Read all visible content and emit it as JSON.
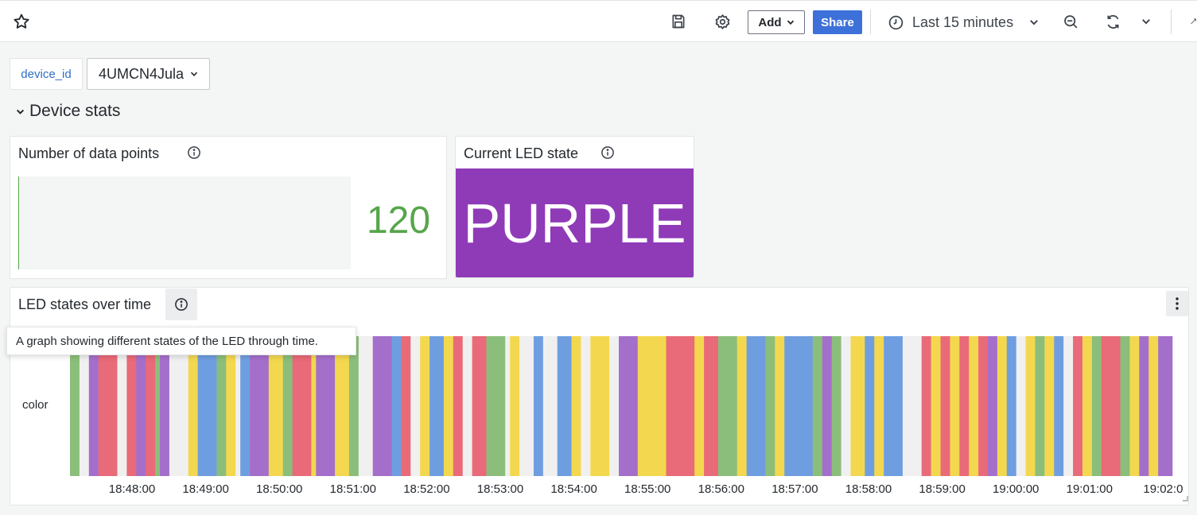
{
  "toolbar": {
    "add_label": "Add",
    "share_label": "Share",
    "time_range": "Last 15 minutes"
  },
  "variables": {
    "label": "device_id",
    "value": "4UMCN4Jula"
  },
  "row": {
    "title": "Device stats"
  },
  "panels": {
    "data_points": {
      "title": "Number of data points",
      "value": "120"
    },
    "led_state": {
      "title": "Current LED state",
      "value": "PURPLE"
    },
    "led_over_time": {
      "title": "LED states over time",
      "tooltip": "A graph showing different states of the LED through time.",
      "y_label": "color"
    }
  },
  "colors": {
    "green": "#8bbe7b",
    "purple": "#a46fcb",
    "red": "#e96a78",
    "yellow": "#f3d84f",
    "blue": "#6f9ee0",
    "gap": "#f0f0f0",
    "current_led": "#8f3bb8",
    "stat_value": "#56a64b"
  },
  "chart_data": {
    "type": "state-timeline",
    "y_label": "color",
    "x_ticks": [
      "18:48:00",
      "18:49:00",
      "18:50:00",
      "18:51:00",
      "18:52:00",
      "18:53:00",
      "18:54:00",
      "18:55:00",
      "18:56:00",
      "18:57:00",
      "18:58:00",
      "18:59:00",
      "19:00:00",
      "19:01:00",
      "19:02:0"
    ],
    "segments": [
      {
        "state": "green",
        "weight": 2
      },
      {
        "state": "gap",
        "weight": 2
      },
      {
        "state": "purple",
        "weight": 2
      },
      {
        "state": "red",
        "weight": 4
      },
      {
        "state": "gap",
        "weight": 2
      },
      {
        "state": "red",
        "weight": 2
      },
      {
        "state": "purple",
        "weight": 2
      },
      {
        "state": "red",
        "weight": 2
      },
      {
        "state": "green",
        "weight": 1
      },
      {
        "state": "purple",
        "weight": 2
      },
      {
        "state": "gap",
        "weight": 4
      },
      {
        "state": "yellow",
        "weight": 2
      },
      {
        "state": "blue",
        "weight": 4
      },
      {
        "state": "green",
        "weight": 2
      },
      {
        "state": "yellow",
        "weight": 2
      },
      {
        "state": "gap",
        "weight": 1
      },
      {
        "state": "blue",
        "weight": 2
      },
      {
        "state": "purple",
        "weight": 4
      },
      {
        "state": "yellow",
        "weight": 3
      },
      {
        "state": "green",
        "weight": 2
      },
      {
        "state": "red",
        "weight": 4
      },
      {
        "state": "yellow",
        "weight": 1
      },
      {
        "state": "purple",
        "weight": 4
      },
      {
        "state": "yellow",
        "weight": 3
      },
      {
        "state": "green",
        "weight": 2
      },
      {
        "state": "gap",
        "weight": 3
      },
      {
        "state": "purple",
        "weight": 4
      },
      {
        "state": "blue",
        "weight": 2
      },
      {
        "state": "red",
        "weight": 2
      },
      {
        "state": "gap",
        "weight": 2
      },
      {
        "state": "yellow",
        "weight": 2
      },
      {
        "state": "blue",
        "weight": 3
      },
      {
        "state": "yellow",
        "weight": 2
      },
      {
        "state": "red",
        "weight": 2
      },
      {
        "state": "gap",
        "weight": 2
      },
      {
        "state": "red",
        "weight": 3
      },
      {
        "state": "green",
        "weight": 4
      },
      {
        "state": "gap",
        "weight": 1
      },
      {
        "state": "yellow",
        "weight": 2
      },
      {
        "state": "gap",
        "weight": 3
      },
      {
        "state": "blue",
        "weight": 2
      },
      {
        "state": "gap",
        "weight": 3
      },
      {
        "state": "blue",
        "weight": 3
      },
      {
        "state": "yellow",
        "weight": 2
      },
      {
        "state": "gap",
        "weight": 2
      },
      {
        "state": "yellow",
        "weight": 4
      },
      {
        "state": "gap",
        "weight": 2
      },
      {
        "state": "purple",
        "weight": 4
      },
      {
        "state": "yellow",
        "weight": 6
      },
      {
        "state": "red",
        "weight": 6
      },
      {
        "state": "yellow",
        "weight": 2
      },
      {
        "state": "red",
        "weight": 3
      },
      {
        "state": "green",
        "weight": 4
      },
      {
        "state": "yellow",
        "weight": 2
      },
      {
        "state": "blue",
        "weight": 4
      },
      {
        "state": "green",
        "weight": 2
      },
      {
        "state": "yellow",
        "weight": 2
      },
      {
        "state": "blue",
        "weight": 6
      },
      {
        "state": "green",
        "weight": 2
      },
      {
        "state": "purple",
        "weight": 2
      },
      {
        "state": "green",
        "weight": 2
      },
      {
        "state": "gap",
        "weight": 2
      },
      {
        "state": "yellow",
        "weight": 3
      },
      {
        "state": "blue",
        "weight": 2
      },
      {
        "state": "yellow",
        "weight": 2
      },
      {
        "state": "blue",
        "weight": 4
      },
      {
        "state": "gap",
        "weight": 4
      },
      {
        "state": "red",
        "weight": 2
      },
      {
        "state": "yellow",
        "weight": 2
      },
      {
        "state": "red",
        "weight": 2
      },
      {
        "state": "yellow",
        "weight": 2
      },
      {
        "state": "red",
        "weight": 2
      },
      {
        "state": "yellow",
        "weight": 2
      },
      {
        "state": "red",
        "weight": 2
      },
      {
        "state": "purple",
        "weight": 2
      },
      {
        "state": "yellow",
        "weight": 2
      },
      {
        "state": "blue",
        "weight": 2
      },
      {
        "state": "gap",
        "weight": 2
      },
      {
        "state": "yellow",
        "weight": 2
      },
      {
        "state": "green",
        "weight": 2
      },
      {
        "state": "yellow",
        "weight": 2
      },
      {
        "state": "blue",
        "weight": 2
      },
      {
        "state": "gap",
        "weight": 2
      },
      {
        "state": "red",
        "weight": 2
      },
      {
        "state": "yellow",
        "weight": 2
      },
      {
        "state": "green",
        "weight": 2
      },
      {
        "state": "red",
        "weight": 4
      },
      {
        "state": "green",
        "weight": 2
      },
      {
        "state": "yellow",
        "weight": 2
      },
      {
        "state": "purple",
        "weight": 2
      },
      {
        "state": "yellow",
        "weight": 2
      },
      {
        "state": "purple",
        "weight": 3
      }
    ]
  }
}
